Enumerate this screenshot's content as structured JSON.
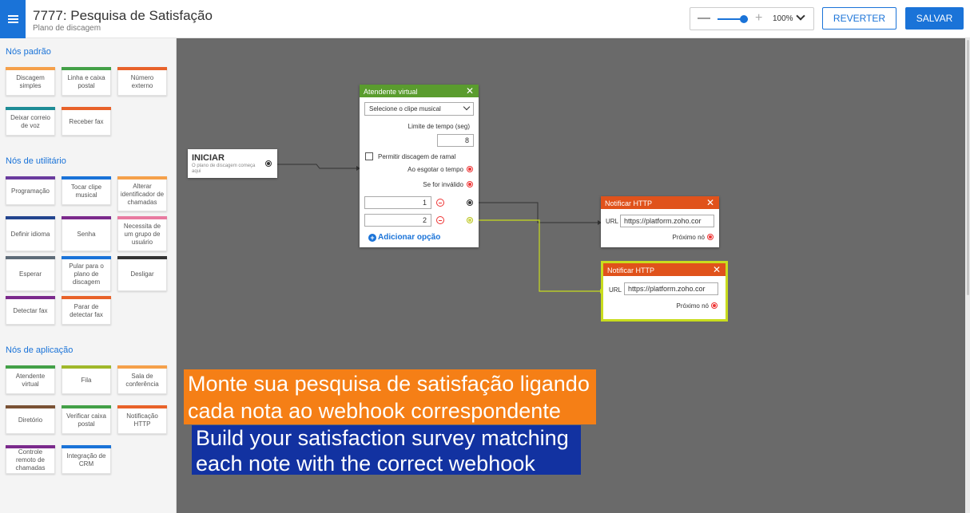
{
  "header": {
    "title": "7777: Pesquisa de Satisfação",
    "subtitle": "Plano de discagem",
    "zoom_level": "100%",
    "zoom_fraction": 0.85,
    "revert_label": "REVERTER",
    "save_label": "SALVAR"
  },
  "sidebar": {
    "sections": [
      {
        "title": "Nós padrão",
        "cards": [
          {
            "label": "Discagem simples",
            "color": "#f5a04a"
          },
          {
            "label": "Linha e caixa postal",
            "color": "#43a047"
          },
          {
            "label": "Número externo",
            "color": "#e8622a"
          },
          {
            "label": "Deixar correio de voz",
            "color": "#1e8c96"
          },
          {
            "label": "Receber fax",
            "color": "#e8622a"
          }
        ]
      },
      {
        "title": "Nós de utilitário",
        "cards": [
          {
            "label": "Programação",
            "color": "#6a3b9e"
          },
          {
            "label": "Tocar clipe musical",
            "color": "#1a73d8"
          },
          {
            "label": "Alterar identificador de chamadas",
            "color": "#f5a04a"
          },
          {
            "label": "Definir idioma",
            "color": "#23458f"
          },
          {
            "label": "Senha",
            "color": "#7b2a8c"
          },
          {
            "label": "Necessita de um grupo de usuário",
            "color": "#e87aa0"
          },
          {
            "label": "Esperar",
            "color": "#5d6b78"
          },
          {
            "label": "Pular para o plano de discagem",
            "color": "#1a73d8"
          },
          {
            "label": "Desligar",
            "color": "#333333"
          },
          {
            "label": "Detectar fax",
            "color": "#7b2a8c"
          },
          {
            "label": "Parar de detectar fax",
            "color": "#e8622a"
          }
        ]
      },
      {
        "title": "Nós de aplicação",
        "cards": [
          {
            "label": "Atendente virtual",
            "color": "#43a047"
          },
          {
            "label": "Fila",
            "color": "#a0b82a"
          },
          {
            "label": "Sala de conferência",
            "color": "#f5a04a"
          },
          {
            "label": "Diretório",
            "color": "#7a5235"
          },
          {
            "label": "Verificar caixa postal",
            "color": "#43a047"
          },
          {
            "label": "Notificação HTTP",
            "color": "#e8622a"
          },
          {
            "label": "Controle remoto de chamadas",
            "color": "#7b2a8c"
          },
          {
            "label": "Integração de CRM",
            "color": "#1a73d8"
          }
        ]
      }
    ]
  },
  "canvas": {
    "start_node": {
      "title": "INICIAR",
      "description": "O plano de discagem começa aqui"
    },
    "virtual_attendant": {
      "title": "Atendente virtual",
      "header_color": "#5a9c2e",
      "music_select": "Selecione o clipe musical",
      "time_limit_label": "Limite de tempo (seg)",
      "time_limit_value": "8",
      "allow_extension_label": "Permitir discagem de ramal",
      "timeout_label": "Ao esgotar o tempo",
      "invalid_label": "Se for inválido",
      "options": [
        "1",
        "2"
      ],
      "add_option_label": "Adicionar opção"
    },
    "http_nodes": [
      {
        "title": "Notificar HTTP",
        "url_label": "URL",
        "url_value": "https://platform.zoho.cor",
        "next_label": "Próximo nó",
        "header_color": "#e0521b"
      },
      {
        "title": "Notificar HTTP",
        "url_label": "URL",
        "url_value": "https://platform.zoho.cor",
        "next_label": "Próximo nó",
        "header_color": "#e0521b"
      }
    ]
  },
  "captions": {
    "pt_line1": "Monte sua pesquisa de satisfação ligando",
    "pt_line2": "cada nota ao webhook correspondente",
    "en_line1": "Build your satisfaction survey matching",
    "en_line2": "each note with the correct webhook"
  }
}
